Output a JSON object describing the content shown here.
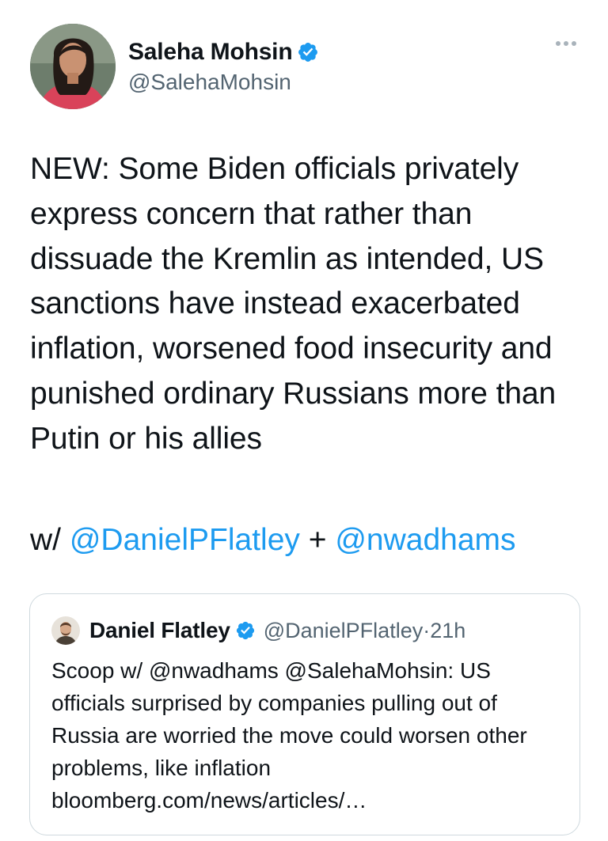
{
  "author": {
    "display_name": "Saleha Mohsin",
    "handle": "@SalehaMohsin",
    "verified": true
  },
  "tweet": {
    "text": "NEW: Some Biden officials privately express concern that rather than dissuade the Kremlin as intended, US sanctions have instead exacerbated inflation, worsened food insecurity and punished ordinary Russians more than Putin or his allies",
    "mention_prefix": "w/ ",
    "mention_1": "@DanielPFlatley",
    "mention_separator": " + ",
    "mention_2": "@nwadhams"
  },
  "quoted_tweet": {
    "display_name": "Daniel Flatley",
    "handle": "@DanielPFlatley",
    "separator": " · ",
    "time": "21h",
    "verified": true,
    "text": "Scoop w/ @nwadhams @SalehaMohsin: US officials surprised by companies pulling out of Russia are worried the move could worsen other problems, like inflation bloomberg.com/news/articles/…"
  },
  "icons": {
    "more": "more-options-icon",
    "verified": "verified-badge-icon"
  },
  "colors": {
    "link": "#1d9bf0",
    "verified": "#1d9bf0",
    "secondary_text": "#536471",
    "border": "#cfd9de"
  }
}
